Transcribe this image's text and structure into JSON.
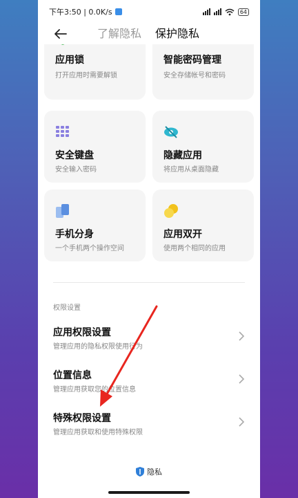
{
  "status": {
    "time_speed": "下午3:50 | 0.0K/s",
    "battery": "64"
  },
  "header": {
    "tab_inactive": "了解隐私",
    "tab_active": "保护隐私"
  },
  "cards": [
    {
      "title": "应用锁",
      "subtitle": "打开应用时需要解锁",
      "icon": "shield-icon",
      "color": "#4cbb5a"
    },
    {
      "title": "智能密码管理",
      "subtitle": "安全存储帐号和密码",
      "icon": "key-box-icon",
      "color": "#f07a4a"
    },
    {
      "title": "安全键盘",
      "subtitle": "安全输入密码",
      "icon": "keyboard-grid-icon",
      "color": "#8a7fe0"
    },
    {
      "title": "隐藏应用",
      "subtitle": "将应用从桌面隐藏",
      "icon": "eye-off-icon",
      "color": "#2fb7cf"
    },
    {
      "title": "手机分身",
      "subtitle": "一个手机两个操作空间",
      "icon": "dual-phone-icon",
      "color": "#5b8fe0"
    },
    {
      "title": "应用双开",
      "subtitle": "使用两个相同的应用",
      "icon": "twin-circles-icon",
      "color": "#f2c21c"
    }
  ],
  "permissions": {
    "section_label": "权限设置",
    "rows": [
      {
        "title": "应用权限设置",
        "subtitle": "管理应用的隐私权限使用行为"
      },
      {
        "title": "位置信息",
        "subtitle": "管理应用获取您的位置信息"
      },
      {
        "title": "特殊权限设置",
        "subtitle": "管理应用获取和使用特殊权限"
      }
    ]
  },
  "footer": {
    "brand": "隐私",
    "brand_color": "#2f7fd8"
  },
  "annotation": {
    "arrow_color": "#e8261f"
  }
}
